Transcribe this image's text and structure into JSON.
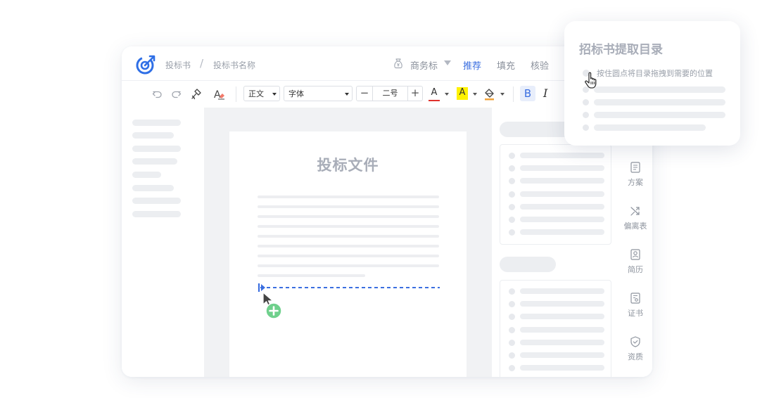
{
  "header": {
    "breadcrumb": [
      "投标书",
      "投标书名称"
    ],
    "breadcrumb_separator": "/",
    "bag_icon": "money-bag-icon",
    "bid_type": "商务标",
    "nav": [
      {
        "label": "推荐",
        "active": true
      },
      {
        "label": "填充",
        "active": false
      },
      {
        "label": "核验",
        "active": false
      }
    ]
  },
  "toolbar": {
    "paragraph_style": "正文",
    "font": "字体",
    "font_size": "二号",
    "minus": "−",
    "plus": "+",
    "font_color_glyph": "A",
    "highlight_glyph": "A",
    "bold": "B",
    "italic": "I",
    "colors": {
      "font_color": "#e0322d",
      "highlight": "#fff200",
      "accent": "#3b6fe0"
    }
  },
  "document": {
    "title": "投标文件"
  },
  "side_rail": [
    {
      "label": "方案",
      "icon": "document-icon"
    },
    {
      "label": "偏离表",
      "icon": "shuffle-icon"
    },
    {
      "label": "简历",
      "icon": "resume-icon"
    },
    {
      "label": "证书",
      "icon": "certificate-icon"
    },
    {
      "label": "资质",
      "icon": "shield-check-icon"
    }
  ],
  "popup": {
    "title": "招标书提取目录",
    "hint": "按住圆点将目录拖拽到需要的位置"
  }
}
